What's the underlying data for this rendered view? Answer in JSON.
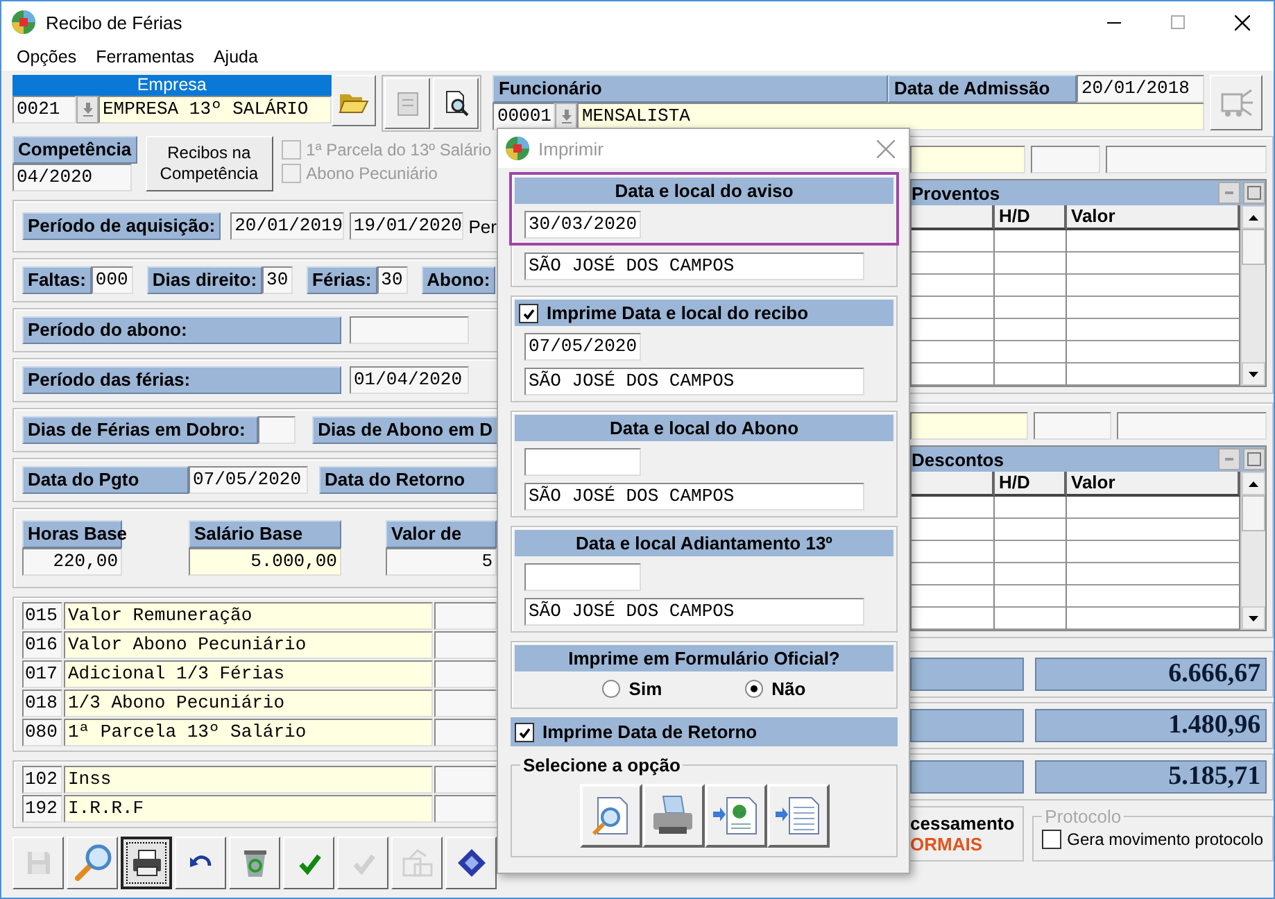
{
  "window": {
    "title": "Recibo de Férias"
  },
  "menu": [
    "Opções",
    "Ferramentas",
    "Ajuda"
  ],
  "empresa": {
    "label": "Empresa",
    "code": "0021",
    "name": "EMPRESA 13º SALÁRIO"
  },
  "funcionario": {
    "label": "Funcionário",
    "code": "00001",
    "name": "MENSALISTA",
    "admissao_label": "Data de Admissão",
    "admissao": "20/01/2018"
  },
  "competencia": {
    "label": "Competência",
    "value": "04/2020",
    "button": "Recibos na Competência",
    "options": [
      {
        "label": "1ª Parcela do 13º Salário",
        "checked": false,
        "disabled": true
      },
      {
        "label": "Abono Pecuniário",
        "checked": false,
        "disabled": true
      }
    ]
  },
  "aquisicao": {
    "label": "Período de aquisição:",
    "start": "20/01/2019",
    "end": "19/01/2020",
    "cut_label": "Per"
  },
  "dias": [
    {
      "label": "Faltas:",
      "value": "000"
    },
    {
      "label": "Dias direito:",
      "value": "30"
    },
    {
      "label": "Férias:",
      "value": "30"
    },
    {
      "label": "Abono:"
    }
  ],
  "periodo_abono": {
    "label": "Período do abono:"
  },
  "periodo_ferias": {
    "label": "Período das férias:",
    "value": "01/04/2020"
  },
  "dobro": {
    "label": "Dias de Férias em Dobro:",
    "cut_label": "Dias de Abono em D"
  },
  "pagamento": {
    "label": "Data do Pgto",
    "value": "07/05/2020",
    "retorno_label": "Data do Retorno"
  },
  "bases": [
    {
      "label": "Horas Base",
      "value": "220,00",
      "editable": false
    },
    {
      "label": "Salário Base",
      "value": "5.000,00",
      "editable": true
    },
    {
      "label": "Valor de",
      "value": "5",
      "editable": false
    }
  ],
  "proventos_itens": [
    {
      "code": "015",
      "description": "Valor Remuneração"
    },
    {
      "code": "016",
      "description": "Valor Abono Pecuniário"
    },
    {
      "code": "017",
      "description": "Adicional 1/3 Férias"
    },
    {
      "code": "018",
      "description": "1/3 Abono Pecuniário"
    },
    {
      "code": "080",
      "description": "1ª Parcela 13º Salário"
    }
  ],
  "descontos_itens": [
    {
      "code": "102",
      "description": "Inss"
    },
    {
      "code": "192",
      "description": "I.R.R.F"
    }
  ],
  "toolbar": [
    {
      "kind": "save",
      "disabled": true,
      "focused": false
    },
    {
      "kind": "search",
      "disabled": false,
      "focused": false
    },
    {
      "kind": "print",
      "disabled": false,
      "focused": true
    },
    {
      "kind": "undo",
      "disabled": false,
      "focused": false
    },
    {
      "kind": "recycle",
      "disabled": false,
      "focused": false
    },
    {
      "kind": "confirm",
      "disabled": false,
      "focused": false
    },
    {
      "kind": "confirm",
      "disabled": true,
      "focused": false
    },
    {
      "kind": "export",
      "disabled": true,
      "focused": false
    },
    {
      "kind": "network",
      "disabled": false,
      "focused": false
    }
  ],
  "proventos": {
    "title": "Proventos",
    "columns": [
      "H/D",
      "Valor"
    ]
  },
  "descontos": {
    "title": "Descontos",
    "columns": [
      "H/D",
      "Valor"
    ]
  },
  "totals": [
    "6.666,67",
    "1.480,96",
    "5.185,71"
  ],
  "processamento": {
    "label": "cessamento",
    "value": "ORMAIS"
  },
  "protocolo": {
    "title": "Protocolo",
    "option": {
      "label": "Gera movimento protocolo",
      "checked": false
    }
  },
  "print_dialog": {
    "title": "Imprimir",
    "sections": [
      {
        "kind": "header",
        "title": "Data e local do aviso",
        "date": "30/03/2020",
        "place": "SÃO JOSÉ DOS CAMPOS",
        "highlighted": true
      },
      {
        "kind": "check",
        "title": "Imprime Data e local do recibo",
        "checked": true,
        "date": "07/05/2020",
        "place": "SÃO JOSÉ DOS CAMPOS"
      },
      {
        "kind": "header",
        "title": "Data e local do Abono",
        "place": "SÃO JOSÉ DOS CAMPOS"
      },
      {
        "kind": "header",
        "title": "Data e local Adiantamento 13º",
        "place": "SÃO JOSÉ DOS CAMPOS"
      }
    ],
    "formulario": {
      "title": "Imprime em Formulário Oficial?",
      "options": [
        {
          "label": "Sim",
          "selected": false
        },
        {
          "label": "Não",
          "selected": true
        }
      ]
    },
    "retorno": {
      "label": "Imprime Data de Retorno",
      "checked": true
    },
    "output": {
      "title": "Selecione a opção",
      "buttons": [
        {
          "kind": "preview"
        },
        {
          "kind": "printer"
        },
        {
          "kind": "web"
        },
        {
          "kind": "text"
        }
      ]
    }
  }
}
